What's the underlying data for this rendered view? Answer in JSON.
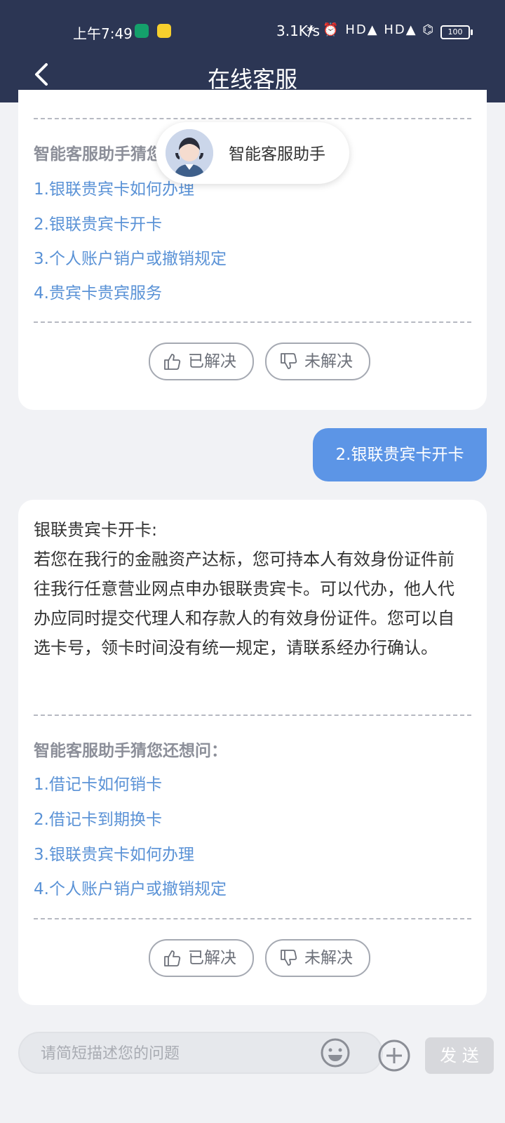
{
  "status": {
    "time": "上午7:49",
    "speed": "3.1K/s",
    "right_icons": "✶ ⏰ HD▲ HD▲ ⌬",
    "battery": "100"
  },
  "header": {
    "title": "在线客服"
  },
  "agent": {
    "name": "智能客服助手"
  },
  "card1": {
    "title": "智能客服助手猜您还想问：",
    "links": [
      "1.银联贵宾卡如何办理",
      "2.银联贵宾卡开卡",
      "3.个人账户销户或撤销规定",
      "4.贵宾卡贵宾服务"
    ],
    "resolved_label": "已解决",
    "unresolved_label": "未解决"
  },
  "user_message": "2.银联贵宾卡开卡",
  "card2": {
    "answer": "银联贵宾卡开卡:\n若您在我行的金融资产达标，您可持本人有效身份证件前往我行任意营业网点申办银联贵宾卡。可以代办，他人代办应同时提交代理人和存款人的有效身份证件。您可以自选卡号，领卡时间没有统一规定，请联系经办行确认。",
    "title": "智能客服助手猜您还想问：",
    "links": [
      "1.借记卡如何销卡",
      "2.借记卡到期换卡",
      "3.银联贵宾卡如何办理",
      "4.个人账户销户或撤销规定"
    ],
    "resolved_label": "已解决",
    "unresolved_label": "未解决"
  },
  "input": {
    "placeholder": "请简短描述您的问题",
    "send_label": "发 送"
  }
}
